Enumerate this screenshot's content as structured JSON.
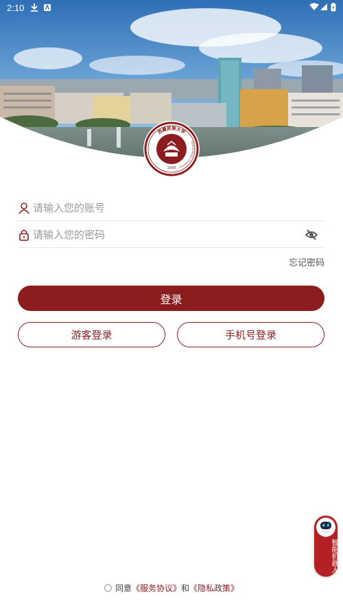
{
  "status_bar": {
    "time": "2:10"
  },
  "emblem": {
    "name_cn": "西藏民族大学",
    "name_en": "Xizang Minzu University",
    "year": "1958"
  },
  "login_form": {
    "account_placeholder": "请输入您的账号",
    "password_placeholder": "请输入您的密码",
    "forgot_password": "忘记密码"
  },
  "buttons": {
    "login": "登录",
    "guest_login": "游客登录",
    "phone_login": "手机号登录"
  },
  "robot": {
    "label": "智能机器人"
  },
  "agreement": {
    "prefix": "同意",
    "service": "《服务协议》",
    "and": "和",
    "privacy": "《隐私政策》"
  },
  "colors": {
    "brand": "#8b1d1f",
    "robot": "#b52024"
  }
}
